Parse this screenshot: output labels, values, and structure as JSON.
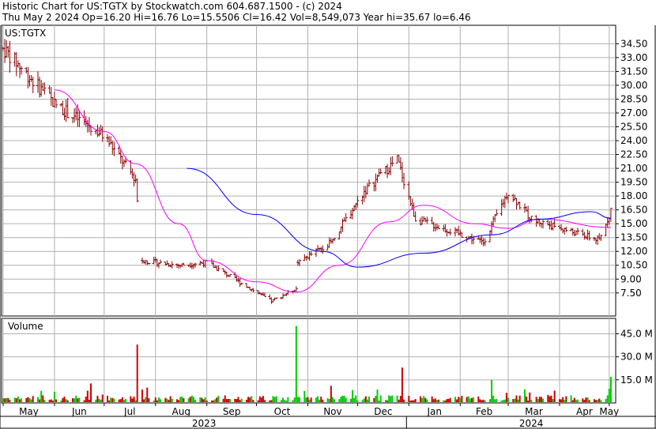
{
  "header": {
    "line1": "Historic Chart for US:TGTX by Stockwatch.com 604.687.1500 - (c) 2024",
    "line2": "Thu May  2 2024   Op=16.20  Hi=16.76  Lo=15.5506  Cl=16.42  Vol=8,549,073   Year hi=35.67  lo=6.46"
  },
  "chart_data": {
    "type": "candlestick",
    "symbol_label": "US:TGTX",
    "volume_label": "Volume",
    "price_axis": {
      "ticks": [
        "34.50",
        "33.00",
        "31.50",
        "30.00",
        "28.50",
        "27.00",
        "25.50",
        "24.00",
        "22.50",
        "21.00",
        "19.50",
        "18.00",
        "16.50",
        "15.00",
        "13.50",
        "12.00",
        "10.50",
        "9.00",
        "7.50"
      ],
      "ylim": [
        5.0,
        36.5
      ]
    },
    "volume_axis": {
      "ticks": [
        "45.0 M",
        "30.0 M",
        "15.0 M"
      ],
      "ylim": [
        0,
        55
      ]
    },
    "x_axis": {
      "months": [
        "May",
        "Jun",
        "Jul",
        "Aug",
        "Sep",
        "Oct",
        "Nov",
        "Dec",
        "Jan",
        "Feb",
        "Mar",
        "Apr",
        "May"
      ],
      "years": [
        "2023",
        "2024"
      ]
    },
    "colors": {
      "bar": "#8b0000",
      "ma_short": "#ff00ff",
      "ma_long": "#0000ff",
      "vol_up": "#00cc00",
      "vol_down": "#cc0000",
      "grid": "#b0b0b0",
      "frame": "#000000"
    },
    "key_points": [
      {
        "date": "2023-05-01",
        "close": 34.0
      },
      {
        "date": "2023-06-01",
        "close": 28.0
      },
      {
        "date": "2023-07-01",
        "close": 24.5
      },
      {
        "date": "2023-07-20",
        "close": 19.8
      },
      {
        "date": "2023-07-24",
        "close": 11.0
      },
      {
        "date": "2023-08-15",
        "close": 10.5
      },
      {
        "date": "2023-09-01",
        "close": 10.8
      },
      {
        "date": "2023-10-10",
        "close": 6.6
      },
      {
        "date": "2023-10-25",
        "close": 8.0
      },
      {
        "date": "2023-10-26",
        "close": 10.8
      },
      {
        "date": "2023-11-15",
        "close": 13.0
      },
      {
        "date": "2023-12-05",
        "close": 18.5
      },
      {
        "date": "2023-12-25",
        "close": 22.0
      },
      {
        "date": "2024-01-05",
        "close": 15.5
      },
      {
        "date": "2024-02-15",
        "close": 13.0
      },
      {
        "date": "2024-03-01",
        "close": 18.5
      },
      {
        "date": "2024-03-15",
        "close": 15.5
      },
      {
        "date": "2024-04-25",
        "close": 13.2
      },
      {
        "date": "2024-05-02",
        "close": 16.42
      }
    ],
    "volume_spikes": [
      {
        "date": "2023-07-21",
        "value": 38.0
      },
      {
        "date": "2023-10-25",
        "value": 50.0
      },
      {
        "date": "2023-12-28",
        "value": 23.0
      },
      {
        "date": "2024-02-20",
        "value": 15.0
      },
      {
        "date": "2024-05-02",
        "value": 17.0
      }
    ],
    "ma_short": [
      {
        "date": "2023-06-01",
        "value": 29.5
      },
      {
        "date": "2023-07-01",
        "value": 25.0
      },
      {
        "date": "2023-07-20",
        "value": 21.5
      },
      {
        "date": "2023-08-15",
        "value": 15.0
      },
      {
        "date": "2023-09-01",
        "value": 11.0
      },
      {
        "date": "2023-10-01",
        "value": 8.7
      },
      {
        "date": "2023-10-25",
        "value": 7.6
      },
      {
        "date": "2023-11-20",
        "value": 10.5
      },
      {
        "date": "2023-12-20",
        "value": 15.2
      },
      {
        "date": "2024-01-10",
        "value": 17.0
      },
      {
        "date": "2024-02-10",
        "value": 15.0
      },
      {
        "date": "2024-03-01",
        "value": 14.5
      },
      {
        "date": "2024-03-20",
        "value": 15.5
      },
      {
        "date": "2024-05-02",
        "value": 14.6
      }
    ],
    "ma_long": [
      {
        "date": "2023-08-20",
        "value": 21.0
      },
      {
        "date": "2023-10-01",
        "value": 16.0
      },
      {
        "date": "2023-11-10",
        "value": 12.0
      },
      {
        "date": "2023-12-01",
        "value": 10.3
      },
      {
        "date": "2024-01-10",
        "value": 11.8
      },
      {
        "date": "2024-02-20",
        "value": 13.8
      },
      {
        "date": "2024-03-20",
        "value": 15.5
      },
      {
        "date": "2024-04-20",
        "value": 16.3
      },
      {
        "date": "2024-05-02",
        "value": 15.6
      }
    ]
  }
}
